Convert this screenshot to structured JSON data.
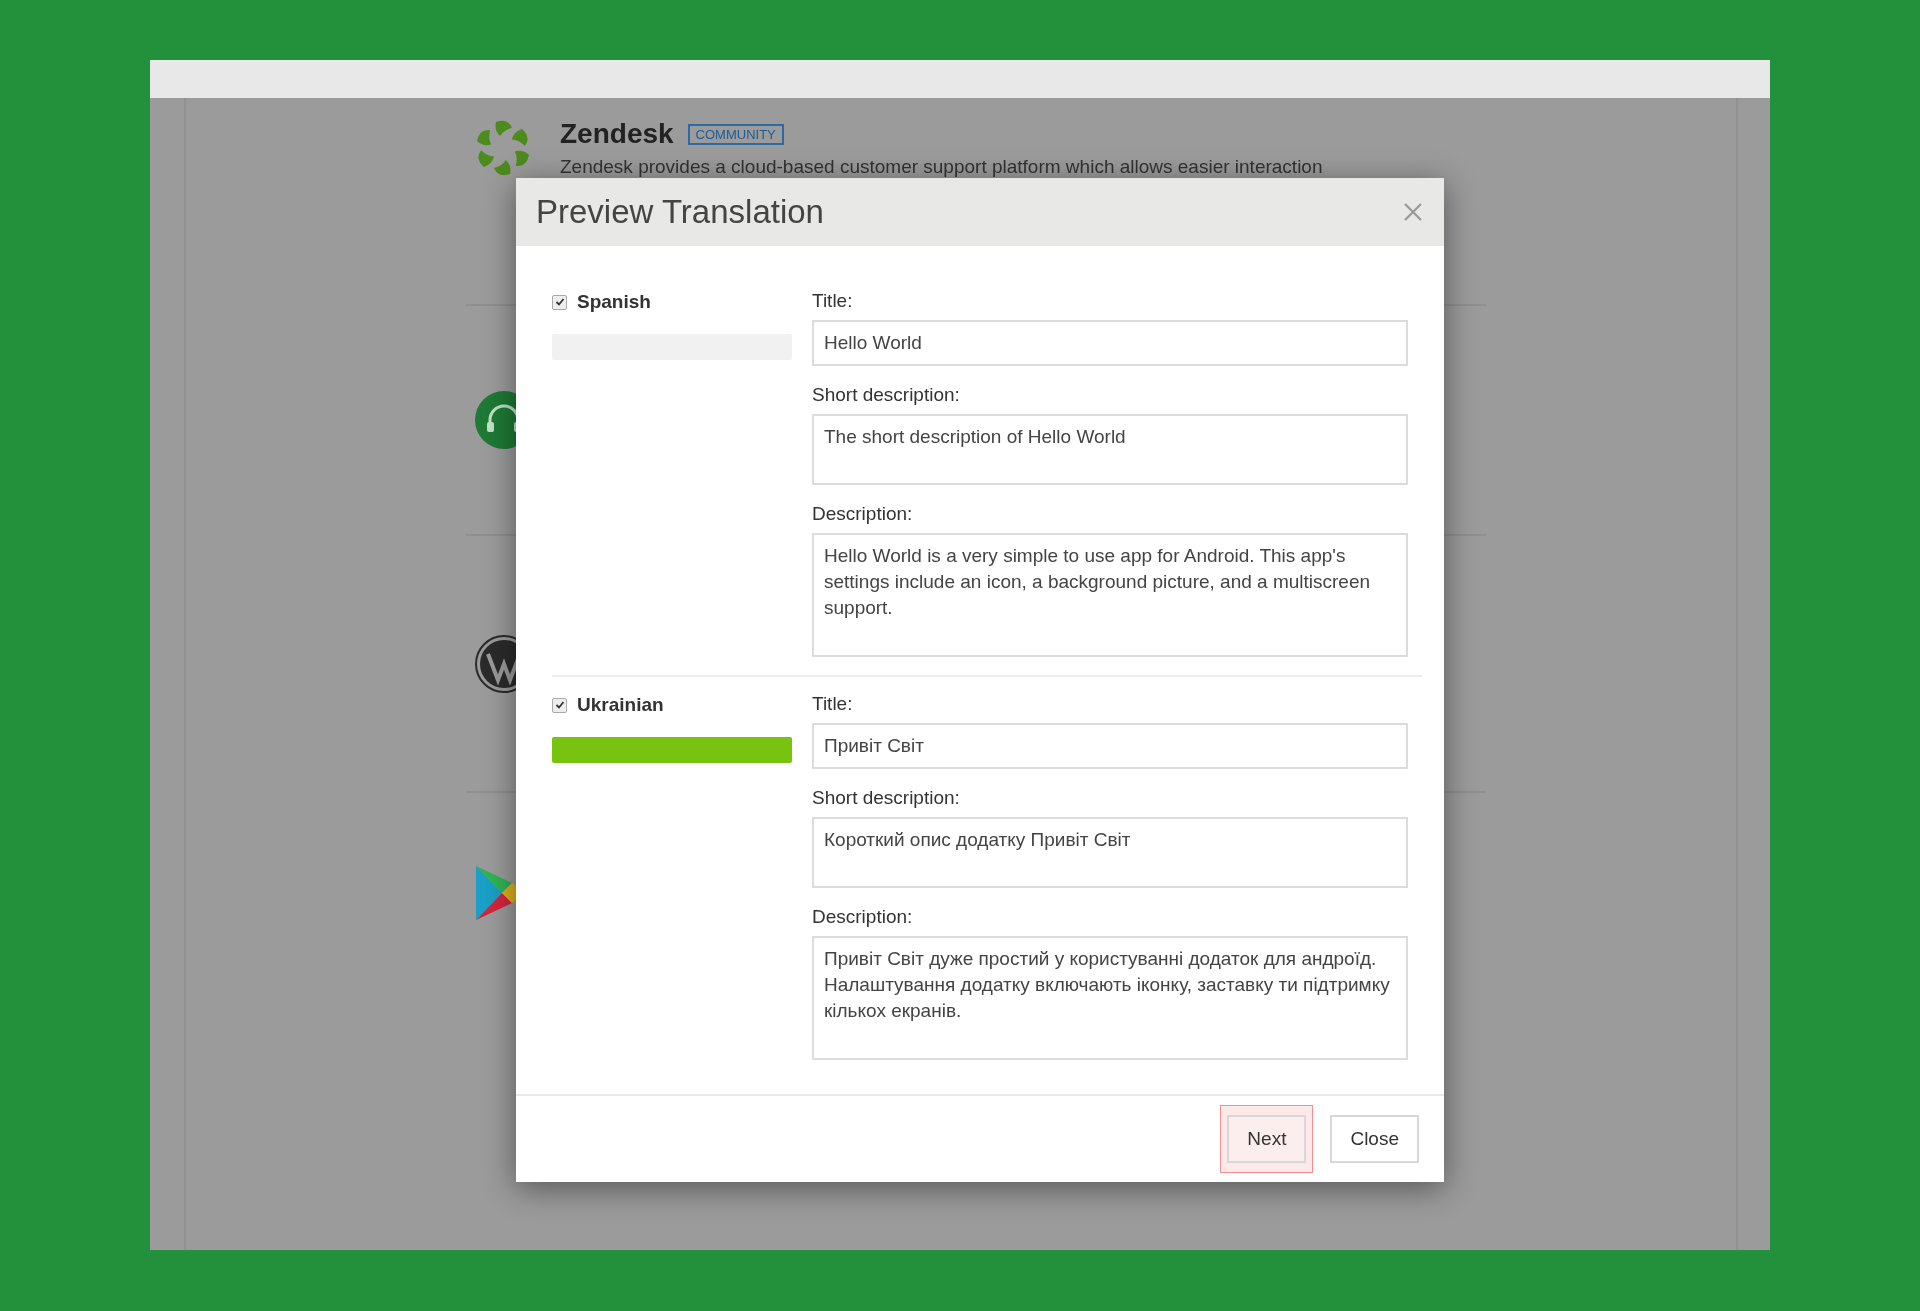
{
  "background_page": {
    "apps": [
      {
        "kind": "zendesk",
        "name": "Zendesk",
        "badge": "COMMUNITY",
        "description": "Zendesk provides a cloud-based customer support platform which allows easier interaction"
      },
      {
        "kind": "headset"
      },
      {
        "kind": "wordpress"
      },
      {
        "kind": "play"
      }
    ]
  },
  "dialog": {
    "title": "Preview Translation",
    "languages": [
      {
        "name": "Spanish",
        "checked": true,
        "level": 0,
        "fields": [
          {
            "kind": "line",
            "label": "Title:",
            "value": "Hello World"
          },
          {
            "kind": "short",
            "label": "Short description:",
            "value": "The short description of Hello World"
          },
          {
            "kind": "long",
            "label": "Description:",
            "value": "Hello World is a very simple to use app for Android. This app's settings include an icon, a background picture, and a multiscreen support."
          }
        ]
      },
      {
        "name": "Ukrainian",
        "checked": true,
        "level": 1,
        "fields": [
          {
            "kind": "line",
            "label": "Title:",
            "value": "Привіт Світ"
          },
          {
            "kind": "short",
            "label": "Short description:",
            "value": "Короткий опис додатку Привіт Світ"
          },
          {
            "kind": "long",
            "label": "Description:",
            "value": "Привіт Світ дуже простий у користуванні додаток для андроїд. Налаштування додатку включають іконку, заставку ти підтримку кількох екранів."
          }
        ]
      }
    ],
    "buttons": [
      {
        "label": "Next",
        "highlighted": true
      },
      {
        "label": "Close",
        "highlighted": false
      }
    ]
  }
}
